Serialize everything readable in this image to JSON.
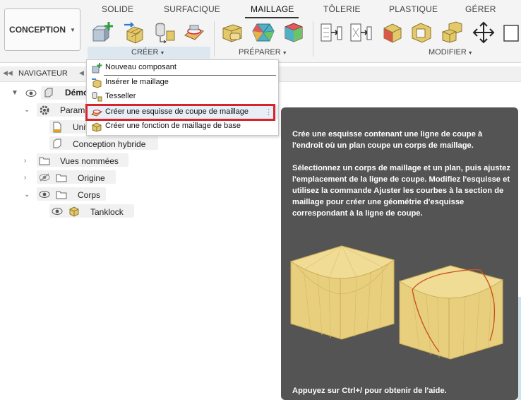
{
  "toolbar": {
    "workspace_label": "CONCEPTION",
    "tabs": [
      "SOLIDE",
      "SURFACIQUE",
      "MAILLAGE",
      "TÔLERIE",
      "PLASTIQUE",
      "GÉRER"
    ],
    "groups": {
      "create": "CRÉER",
      "prepare": "PRÉPARER",
      "modify": "MODIFIER"
    }
  },
  "navigator": {
    "title": "NAVIGATEUR",
    "items": {
      "root": "Démo",
      "params": "Param",
      "units": "Unit",
      "design_history": "Conception hybride",
      "named_views": "Vues nommées",
      "origin": "Origine",
      "bodies": "Corps",
      "body_tanklock": "Tanklock"
    }
  },
  "menu": {
    "items": [
      "Nouveau composant",
      "Insérer le maillage",
      "Tesseller",
      "Créer une esquisse de coupe de maillage",
      "Créer une fonction de maillage de base"
    ]
  },
  "tooltip": {
    "para1": "Crée une esquisse contenant une ligne de coupe à l'endroit où un plan coupe un corps de maillage.",
    "para2": "Sélectionnez un corps de maillage et un plan, puis ajustez l'emplacement de la ligne de coupe. Modifiez l'esquisse et utilisez la commande Ajuster les courbes à la section de maillage pour créer une géométrie d'esquisse correspondant à la ligne de coupe.",
    "help": "Appuyez sur Ctrl+/ pour obtenir de l'aide."
  },
  "colors": {
    "accent_red": "#d8232a",
    "tooltip_bg": "#545454",
    "mesh_yellow": "#e8cf7e"
  }
}
